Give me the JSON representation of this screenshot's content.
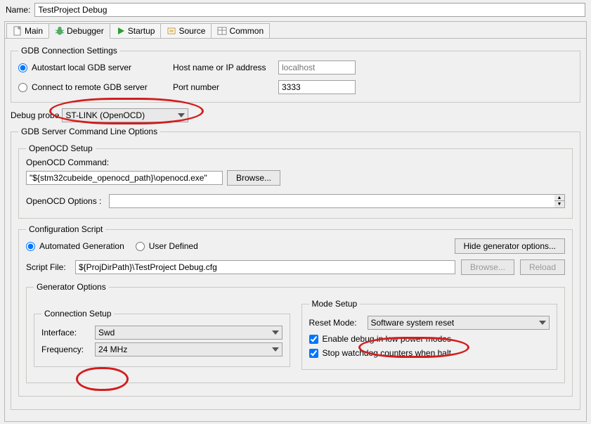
{
  "name_label": "Name:",
  "name_value": "TestProject Debug",
  "tabs": {
    "main": "Main",
    "debugger": "Debugger",
    "startup": "Startup",
    "source": "Source",
    "common": "Common"
  },
  "gdb": {
    "legend": "GDB Connection Settings",
    "autostart": "Autostart local GDB server",
    "connect_remote": "Connect to remote GDB server",
    "host_label": "Host name or IP address",
    "host_value": "localhost",
    "port_label": "Port number",
    "port_value": "3333"
  },
  "debug_probe": {
    "label": "Debug probe",
    "value": "ST-LINK (OpenOCD)"
  },
  "server_opts": {
    "legend": "GDB Server Command Line Options",
    "openocd_setup": {
      "legend": "OpenOCD Setup",
      "cmd_label": "OpenOCD Command:",
      "cmd_value": "\"${stm32cubeide_openocd_path}\\openocd.exe\"",
      "browse": "Browse...",
      "opts_label": "OpenOCD Options :",
      "opts_value": ""
    },
    "config_script": {
      "legend": "Configuration Script",
      "automated": "Automated Generation",
      "user_defined": "User Defined",
      "hide_btn": "Hide generator options...",
      "script_file_label": "Script File:",
      "script_file_value": "${ProjDirPath}\\TestProject Debug.cfg",
      "browse": "Browse...",
      "reload": "Reload",
      "gen_opts": {
        "legend": "Generator Options",
        "conn_setup": {
          "legend": "Connection Setup",
          "interface_label": "Interface:",
          "interface_value": "Swd",
          "freq_label": "Frequency:",
          "freq_value": "24 MHz"
        },
        "mode_setup": {
          "legend": "Mode Setup",
          "reset_label": "Reset Mode:",
          "reset_value": "Software system reset",
          "enable_lp": "Enable debug in low power modes",
          "stop_wd": "Stop watchdog counters when halt"
        }
      }
    }
  }
}
